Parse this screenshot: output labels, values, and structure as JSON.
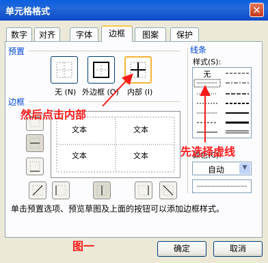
{
  "window": {
    "title": "单元格格式",
    "close_glyph": "✕"
  },
  "tabs": [
    {
      "label": "数字"
    },
    {
      "label": "对齐"
    },
    {
      "label": "字体"
    },
    {
      "label": "边框",
      "active": true
    },
    {
      "label": "图案"
    },
    {
      "label": "保护"
    }
  ],
  "presets": {
    "group_label": "预置",
    "items": [
      {
        "label": "无 (N)",
        "icon": "border-none-icon"
      },
      {
        "label": "外边框 (O)",
        "icon": "border-outline-icon"
      },
      {
        "label": "内部 (I)",
        "icon": "border-inside-icon",
        "selected": true
      }
    ]
  },
  "border": {
    "group_label": "边框",
    "preview_texts": [
      "文本",
      "文本",
      "文本",
      "文本"
    ]
  },
  "line": {
    "group_label": "线条",
    "style_label": "样式(S):",
    "style_none": "无",
    "color_label": "颜色(C):",
    "color_value": "自动"
  },
  "help_text": "单击预置选项、预览草图及上面的按钮可以添加边框样式。",
  "buttons": {
    "ok": "确定",
    "cancel": "取消"
  },
  "annotations": {
    "click_inside": "然后点击内部",
    "select_dashed": "先选择虚线",
    "figure": "图一",
    "color": "#ff1a1a"
  }
}
